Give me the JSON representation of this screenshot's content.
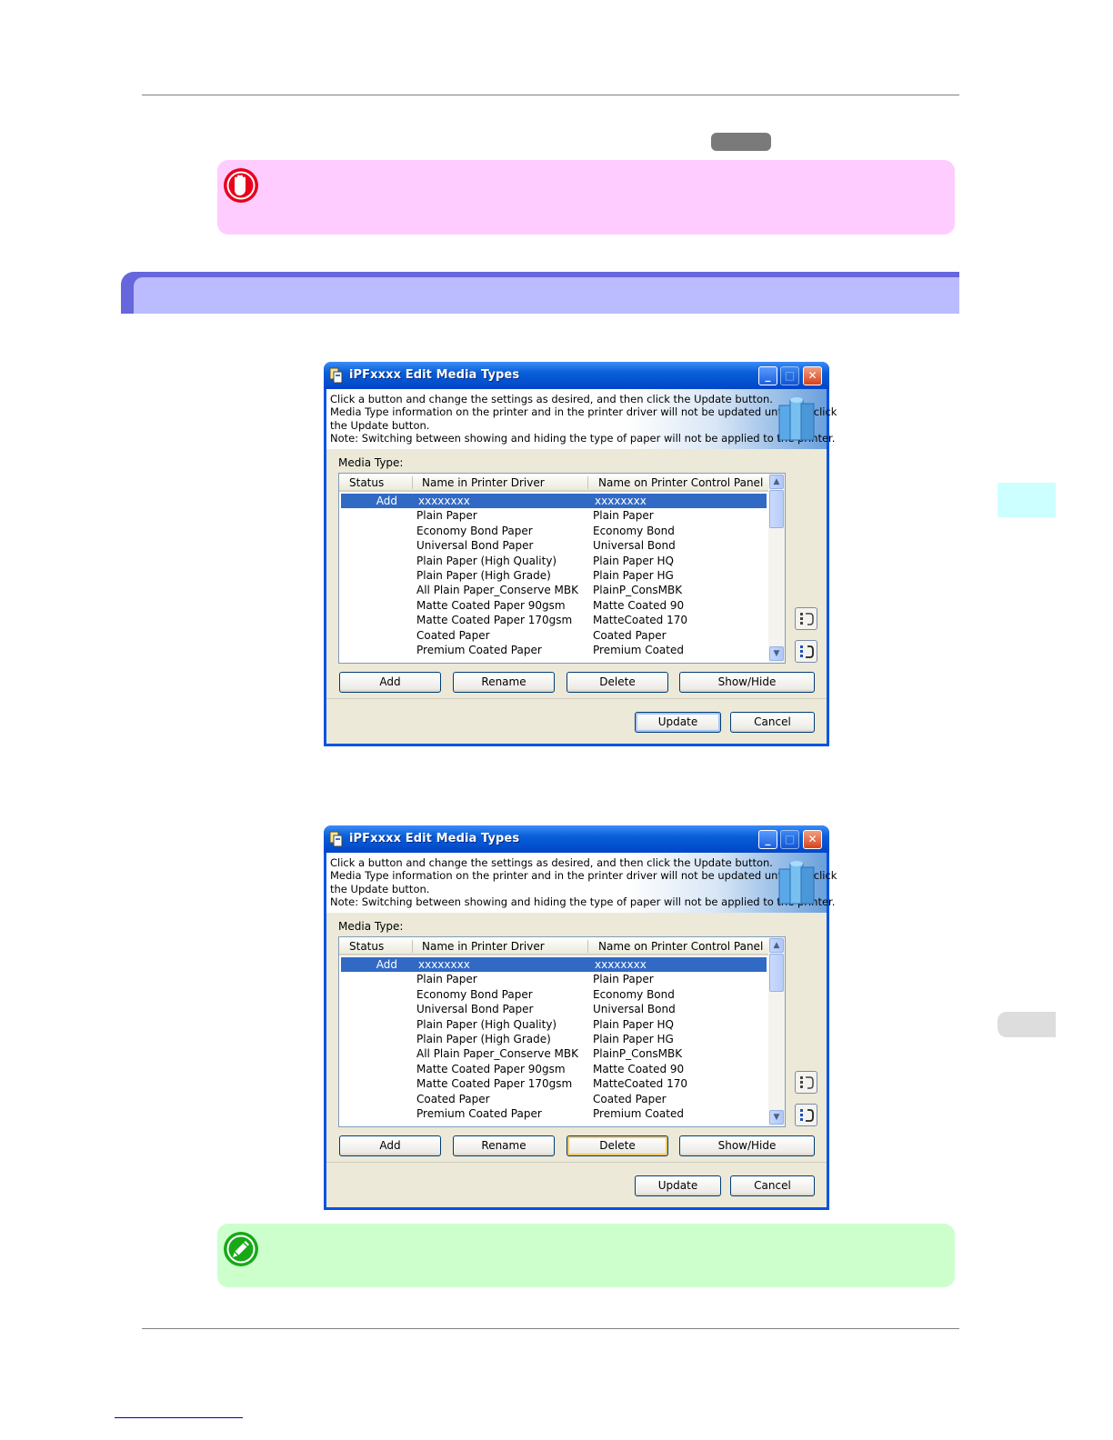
{
  "dialogs": [
    {
      "title": "iPFxxxx Edit Media Types",
      "banner_lines": [
        "Click a button and change the settings as desired, and then click the Update button.",
        "Media Type information on the printer and in the printer driver will not be updated until you click",
        "the Update button.",
        "Note: Switching between showing and hiding the type of paper will not be applied to the printer."
      ],
      "media_type_label": "Media Type:",
      "columns": [
        "Status",
        "Name in Printer Driver",
        "Name on Printer Control Panel"
      ],
      "rows": [
        {
          "status": "Add",
          "name": "xxxxxxxx",
          "panel": "xxxxxxxx"
        },
        {
          "status": "",
          "name": "Plain Paper",
          "panel": "Plain Paper"
        },
        {
          "status": "",
          "name": "Economy Bond Paper",
          "panel": "Economy Bond"
        },
        {
          "status": "",
          "name": "Universal Bond Paper",
          "panel": "Universal Bond"
        },
        {
          "status": "",
          "name": "Plain Paper (High Quality)",
          "panel": "Plain Paper HQ"
        },
        {
          "status": "",
          "name": "Plain Paper (High Grade)",
          "panel": "Plain Paper HG"
        },
        {
          "status": "",
          "name": "All Plain Paper_Conserve MBK",
          "panel": "PlainP_ConsMBK"
        },
        {
          "status": "",
          "name": "Matte Coated Paper 90gsm",
          "panel": "Matte Coated 90"
        },
        {
          "status": "",
          "name": "Matte Coated Paper 170gsm",
          "panel": "MatteCoated 170"
        },
        {
          "status": "",
          "name": "Coated Paper",
          "panel": "Coated Paper"
        },
        {
          "status": "",
          "name": "Premium Coated Paper",
          "panel": "Premium Coated"
        }
      ],
      "buttons": {
        "add": "Add",
        "rename": "Rename",
        "delete": "Delete",
        "show_hide": "Show/Hide",
        "update": "Update",
        "cancel": "Cancel"
      }
    },
    {
      "title": "iPFxxxx Edit Media Types",
      "banner_lines": [
        "Click a button and change the settings as desired, and then click the Update button.",
        "Media Type information on the printer and in the printer driver will not be updated until you click",
        "the Update button.",
        "Note: Switching between showing and hiding the type of paper will not be applied to the printer."
      ],
      "media_type_label": "Media Type:",
      "columns": [
        "Status",
        "Name in Printer Driver",
        "Name on Printer Control Panel"
      ],
      "rows": [
        {
          "status": "Add",
          "name": "xxxxxxxx",
          "panel": "xxxxxxxx"
        },
        {
          "status": "",
          "name": "Plain Paper",
          "panel": "Plain Paper"
        },
        {
          "status": "",
          "name": "Economy Bond Paper",
          "panel": "Economy Bond"
        },
        {
          "status": "",
          "name": "Universal Bond Paper",
          "panel": "Universal Bond"
        },
        {
          "status": "",
          "name": "Plain Paper (High Quality)",
          "panel": "Plain Paper HQ"
        },
        {
          "status": "",
          "name": "Plain Paper (High Grade)",
          "panel": "Plain Paper HG"
        },
        {
          "status": "",
          "name": "All Plain Paper_Conserve MBK",
          "panel": "PlainP_ConsMBK"
        },
        {
          "status": "",
          "name": "Matte Coated Paper 90gsm",
          "panel": "Matte Coated 90"
        },
        {
          "status": "",
          "name": "Matte Coated Paper 170gsm",
          "panel": "MatteCoated 170"
        },
        {
          "status": "",
          "name": "Coated Paper",
          "panel": "Coated Paper"
        },
        {
          "status": "",
          "name": "Premium Coated Paper",
          "panel": "Premium Coated"
        }
      ],
      "buttons": {
        "add": "Add",
        "rename": "Rename",
        "delete": "Delete",
        "show_hide": "Show/Hide",
        "update": "Update",
        "cancel": "Cancel"
      }
    }
  ],
  "icons": {
    "important": "stop-hand-icon",
    "note": "pencil-icon"
  },
  "colors": {
    "important_box": "#ffccff",
    "note_box": "#ccffcc",
    "section_bar": "#bbbbff",
    "selection": "#316ac5",
    "titlebar": "#0054e3"
  }
}
